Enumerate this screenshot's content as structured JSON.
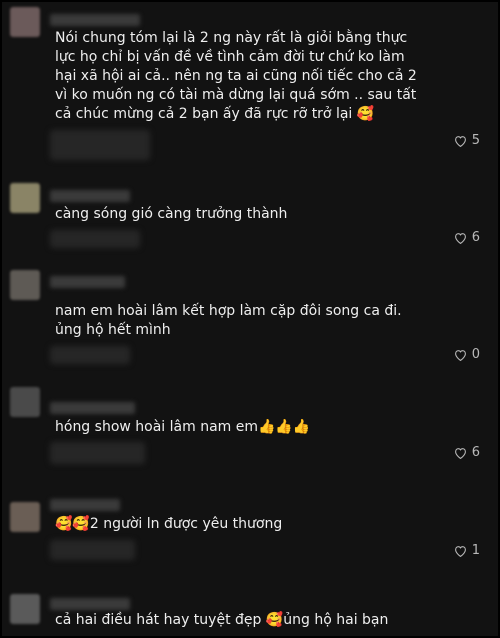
{
  "comments": [
    {
      "text": "Nói chung tóm lại là 2 ng này rất là giỏi bằng thực lực họ chỉ bị vấn đề về tình cảm đời tư chứ ko làm hại xã hội ai cả.. nên ng ta ai cũng nối tiếc cho cả 2 vì ko muốn ng có tài mà dừng lại quá sớm .. sau tất cả chúc mừng cả 2 bạn ấy đã rực rỡ trở lại 🥰",
      "likes": "5"
    },
    {
      "text": "càng sóng gió càng trưởng thành",
      "likes": "6"
    },
    {
      "text": "nam em hoài lâm kết hợp làm cặp đôi song ca đi. ủng hộ hết mình",
      "likes": "0"
    },
    {
      "text": "hóng show hoài lâm nam em👍👍👍",
      "likes": "6"
    },
    {
      "text": "🥰🥰2 người ln được yêu thương",
      "likes": "1"
    },
    {
      "text": "cả hai điều hát hay tuyệt đẹp 🥰ủng hộ hai bạn",
      "likes": ""
    }
  ],
  "colors": {
    "background": "#121212",
    "text": "#efefef",
    "muted": "#b9b9b9"
  }
}
